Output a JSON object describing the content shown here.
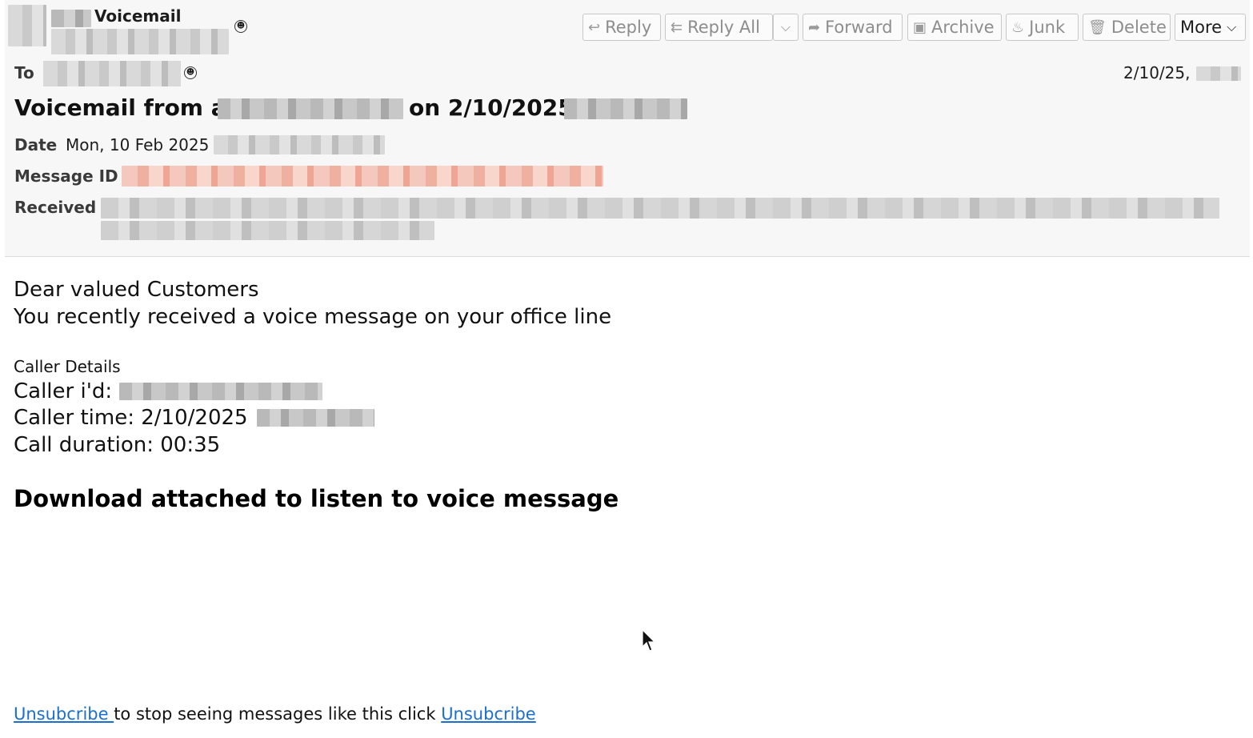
{
  "header": {
    "from_name": "Voicemail",
    "to_label": "To",
    "date_short": "2/10/25,",
    "subject_prefix": "Voicemail from at",
    "subject_middle": "on 2/10/2025",
    "date_label": "Date",
    "date_value": "Mon, 10 Feb 2025",
    "message_id_label": "Message ID",
    "received_label": "Received"
  },
  "toolbar": {
    "reply": "Reply",
    "reply_all": "Reply All",
    "forward": "Forward",
    "archive": "Archive",
    "junk": "Junk",
    "delete": "Delete",
    "more": "More"
  },
  "body": {
    "greeting": "Dear valued Customers",
    "intro": "You recently received a voice message on your office line",
    "caller_details": "Caller Details",
    "caller_id_label": "Caller i'd:",
    "caller_time_label": "Caller time: 2/10/2025",
    "call_duration": "Call duration: 00:35",
    "cta": "Download attached to listen to voice message"
  },
  "footer": {
    "link1": "Unsubcribe ",
    "middle_text": "to stop seeing messages like this click ",
    "link2": "Unsubcribe"
  },
  "colors": {
    "link": "#1a6fd1",
    "header_bg": "#f7f7f7",
    "button_text_disabled": "#8d8d8d"
  },
  "icons": [
    "reply-icon",
    "reply-all-icon",
    "forward-icon",
    "archive-icon",
    "junk-icon",
    "delete-icon",
    "chevron-down-icon",
    "contact-icon",
    "mouse-cursor-icon"
  ]
}
